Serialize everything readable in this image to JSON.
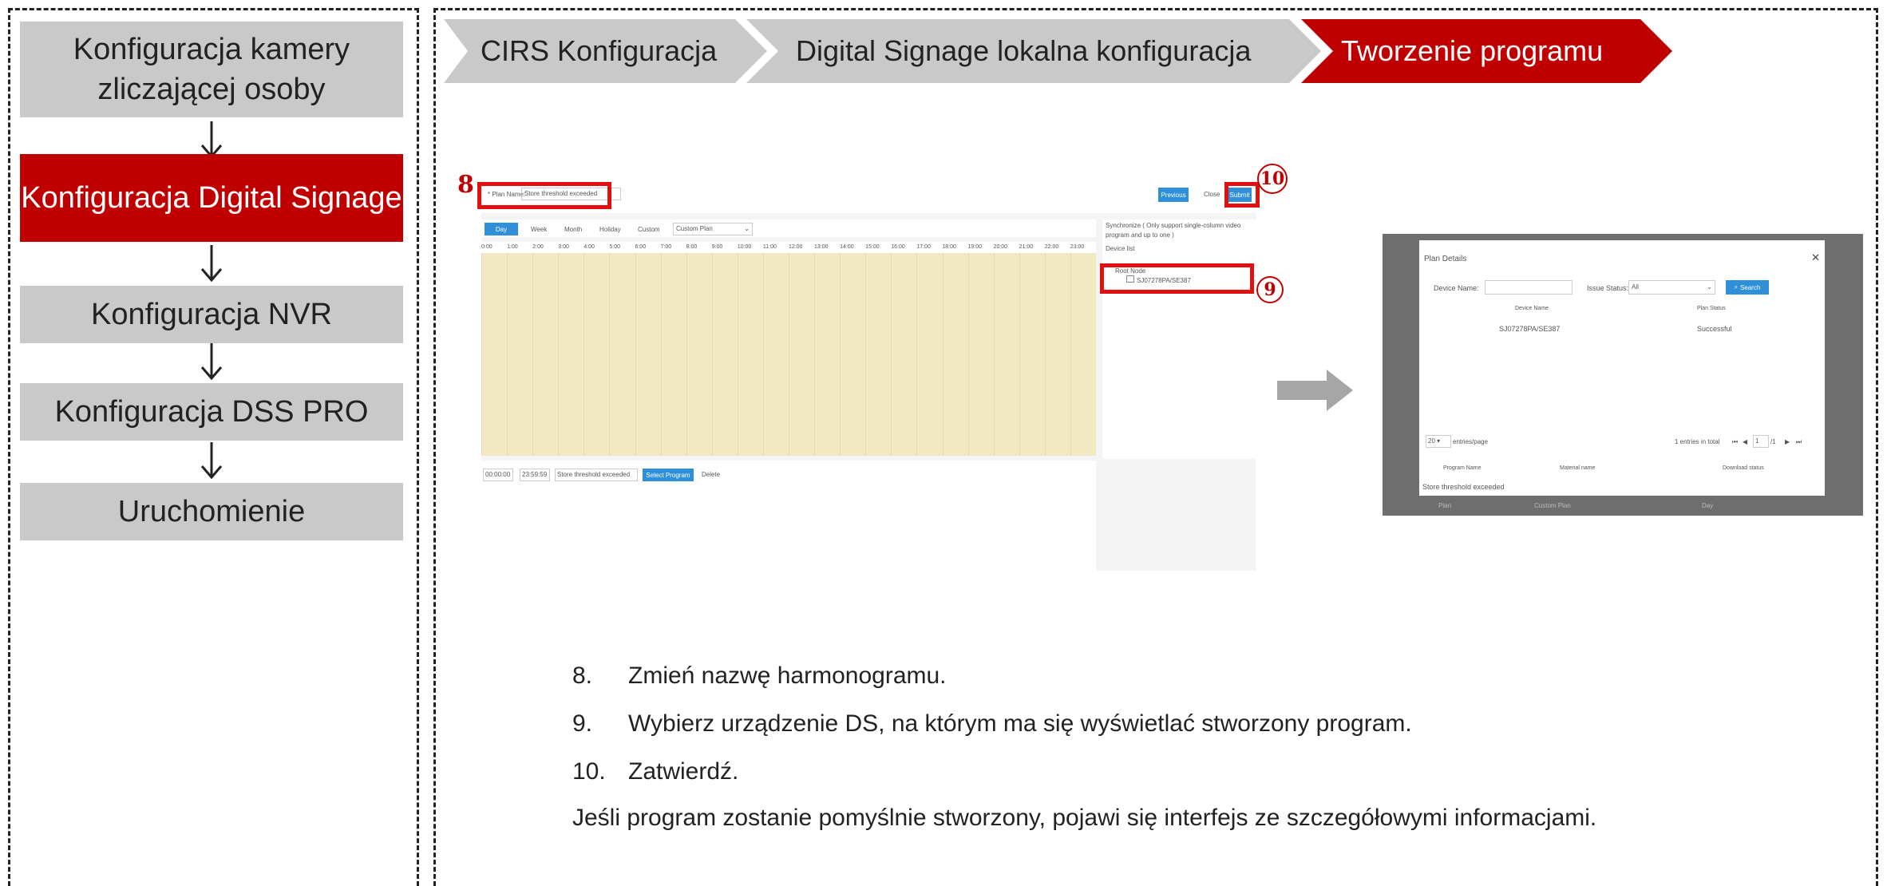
{
  "sidebar": {
    "steps": [
      {
        "label": "Konfiguracja kamery zliczającej osoby",
        "active": false
      },
      {
        "label": "Konfiguracja Digital Signage",
        "active": true
      },
      {
        "label": "Konfiguracja NVR",
        "active": false
      },
      {
        "label": "Konfiguracja DSS PRO",
        "active": false
      },
      {
        "label": "Uruchomienie",
        "active": false
      }
    ]
  },
  "breadcrumb": [
    {
      "label": "CIRS Konfiguracja",
      "active": false
    },
    {
      "label": "Digital Signage lokalna konfiguracja",
      "active": false
    },
    {
      "label": "Tworzenie programu",
      "active": true
    }
  ],
  "screenshot_left": {
    "plan_name_label": "* Plan Name:",
    "plan_name_value": "Store threshold exceeded",
    "buttons": {
      "previous": "Previous",
      "close": "Close",
      "submit": "Submit"
    },
    "tabs": [
      "Day",
      "Week",
      "Month",
      "Holiday",
      "Custom"
    ],
    "plan_select": "Custom Plan",
    "hours": [
      "0:00",
      "1:00",
      "2:00",
      "3:00",
      "4:00",
      "5:00",
      "6:00",
      "7:00",
      "8:00",
      "9:00",
      "10:00",
      "11:00",
      "12:00",
      "13:00",
      "14:00",
      "15:00",
      "16:00",
      "17:00",
      "18:00",
      "19:00",
      "20:00",
      "21:00",
      "22:00",
      "23:00"
    ],
    "synchronize": "Synchronize ( Only support single-column video program and up to one )",
    "device_list": "Device list",
    "root_node": "Root Node",
    "device": "SJ07278PA/SE387",
    "time_start": "00:00:00",
    "time_end": "23:59:59",
    "program_field": "Store threshold exceeded",
    "select_program": "Select Program",
    "delete": "Delete"
  },
  "screenshot_right": {
    "title": "Plan Details",
    "device_name_label": "Device Name:",
    "issue_status_label": "Issue Status:",
    "issue_status_value": "All",
    "search": "Search",
    "col_device": "Device Name",
    "col_status": "Plan Status",
    "row_device": "SJ07278PA/SE387",
    "row_status": "Successful",
    "entries_per_page": "20",
    "entries_label": "entries/page",
    "total": "1 entries in total",
    "page": "1",
    "pages": "/1",
    "col_program": "Program Name",
    "col_material": "Material name",
    "col_download": "Download status",
    "row_program": "Store threshold exceeded",
    "bg_row": [
      "Plan",
      "Custom Plan",
      "Day"
    ]
  },
  "markers": {
    "m8": "8",
    "m9": "9",
    "m10": "10"
  },
  "instructions": [
    {
      "n": "8.",
      "text": "Zmień nazwę harmonogramu."
    },
    {
      "n": "9.",
      "text": "Wybierz urządzenie DS, na którym ma się wyświetlać stworzony program."
    },
    {
      "n": "10.",
      "text": "Zatwierdź."
    }
  ],
  "note": "Jeśli program zostanie pomyślnie stworzony, pojawi się interfejs ze szczegółowymi informacjami.",
  "colors": {
    "accent": "#c00000",
    "inactive": "#c9c9c9",
    "blue": "#2f8fd8",
    "calendar": "#f3e8c4"
  }
}
